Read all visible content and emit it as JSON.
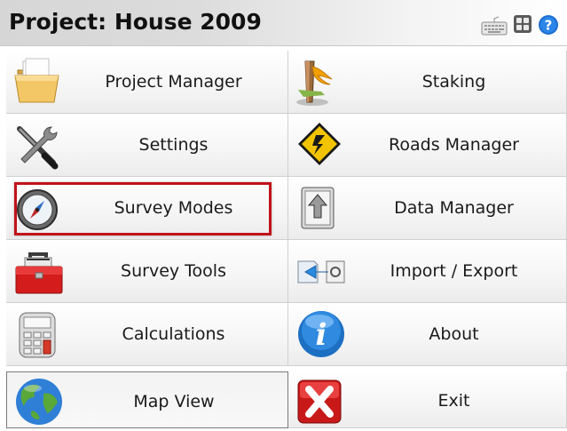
{
  "window": {
    "title": "Project: House 2009"
  },
  "toolbar": {
    "icons": [
      "keyboard-icon",
      "grid-icon",
      "help-icon"
    ]
  },
  "menu": {
    "items": [
      {
        "label": "Project Manager",
        "icon": "folder-icon"
      },
      {
        "label": "Staking",
        "icon": "stake-icon"
      },
      {
        "label": "Settings",
        "icon": "wrench-screwdriver-icon"
      },
      {
        "label": "Roads Manager",
        "icon": "road-sign-icon"
      },
      {
        "label": "Survey Modes",
        "icon": "compass-icon"
      },
      {
        "label": "Data Manager",
        "icon": "data-manager-icon"
      },
      {
        "label": "Survey Tools",
        "icon": "toolbox-icon"
      },
      {
        "label": "Import / Export",
        "icon": "import-export-icon"
      },
      {
        "label": "Calculations",
        "icon": "calculator-icon"
      },
      {
        "label": "About",
        "icon": "info-icon"
      },
      {
        "label": "Map View",
        "icon": "globe-icon"
      },
      {
        "label": "Exit",
        "icon": "exit-icon"
      }
    ]
  },
  "colors": {
    "highlight": "#c1121a",
    "info_blue": "#1d6fc2",
    "exit_red": "#d42020",
    "road_sign_yellow": "#f2c300"
  }
}
